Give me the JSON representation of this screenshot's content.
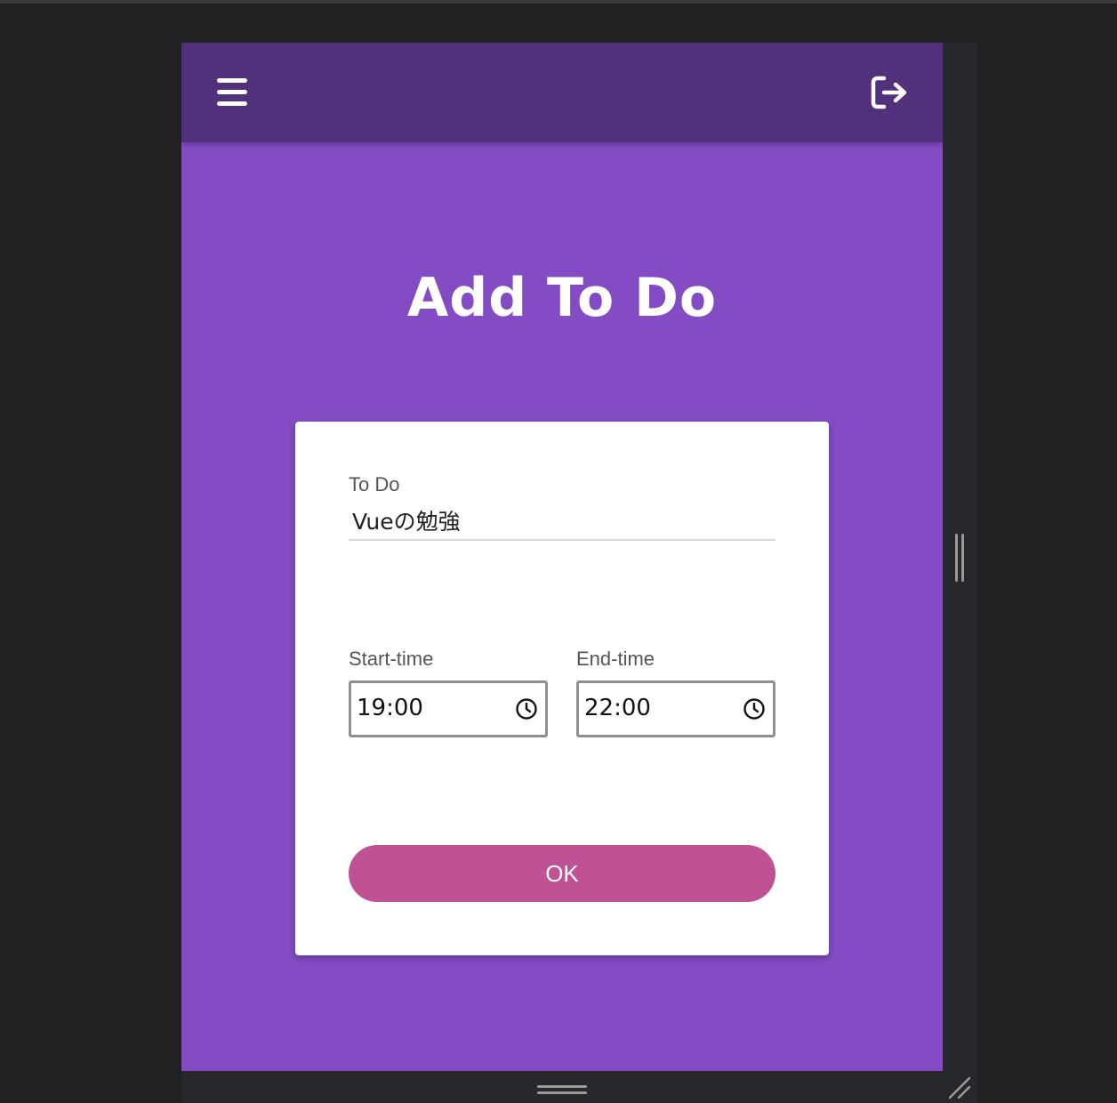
{
  "header": {
    "menu_icon": "hamburger-menu-icon",
    "logout_icon": "sign-out-icon"
  },
  "page": {
    "title": "Add To Do"
  },
  "form": {
    "todo_label": "To Do",
    "todo_value": "Vueの勉強",
    "start_label": "Start-time",
    "start_value": "19:00",
    "end_label": "End-time",
    "end_value": "22:00",
    "clock_icon": "clock-icon",
    "ok_label": "OK"
  },
  "colors": {
    "app_bar": "#51317b",
    "background": "#834cc4",
    "button": "#bf5195",
    "card": "#ffffff"
  }
}
